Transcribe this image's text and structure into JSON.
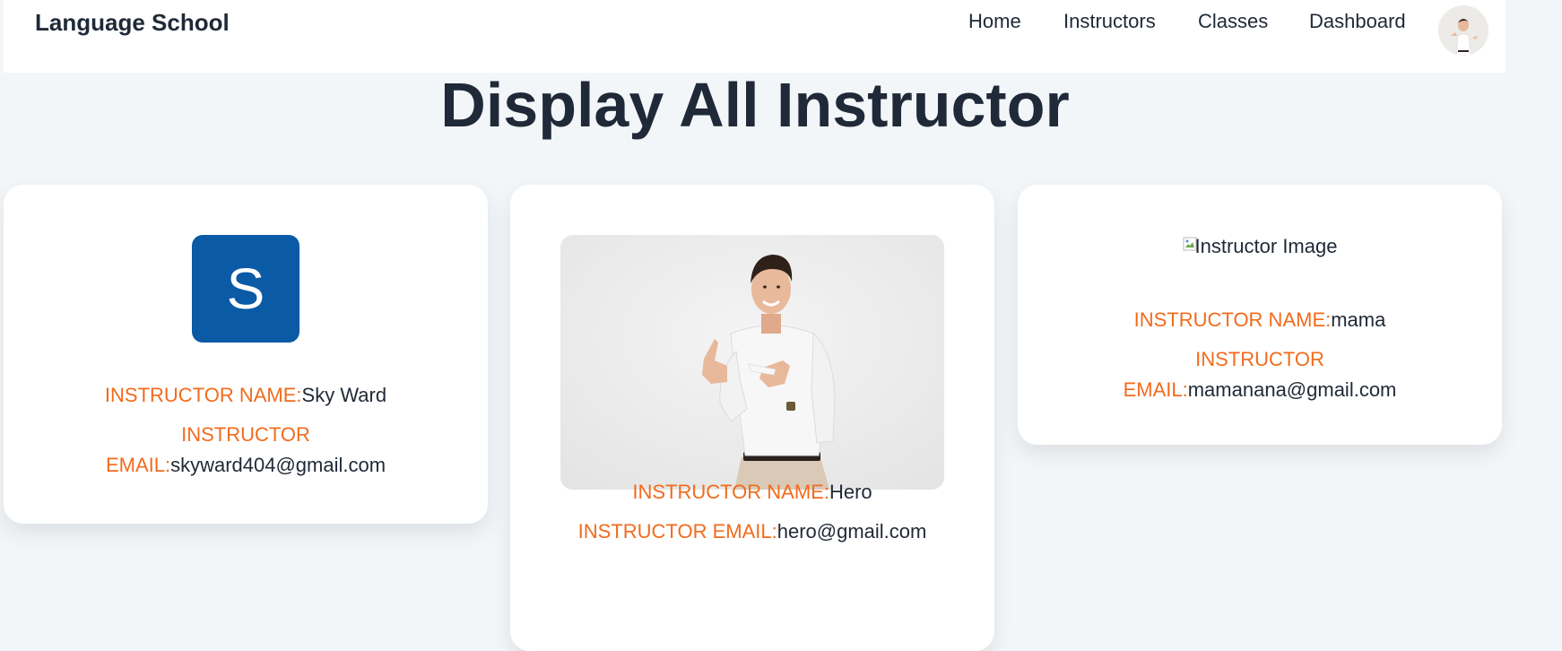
{
  "navbar": {
    "brand": "Language School",
    "links": [
      {
        "label": "Home"
      },
      {
        "label": "Instructors"
      },
      {
        "label": "Classes"
      },
      {
        "label": "Dashboard"
      }
    ]
  },
  "page": {
    "title": "Display All Instructor"
  },
  "labels": {
    "name": "INSTRUCTOR NAME:",
    "email_line1": "INSTRUCTOR",
    "email_line2": "EMAIL:",
    "email_full": "INSTRUCTOR EMAIL:"
  },
  "instructors": [
    {
      "initial": "S",
      "name": "Sky Ward",
      "email": "skyward404@gmail.com",
      "avatar_color": "#0a5aa5"
    },
    {
      "name": "Hero",
      "email": "hero@gmail.com"
    },
    {
      "image_alt": "Instructor Image",
      "name": "mama",
      "email": "mamanana@gmail.com"
    }
  ],
  "colors": {
    "label": "#f26b1d",
    "background": "#f3f6f9",
    "text": "#1f2937"
  }
}
